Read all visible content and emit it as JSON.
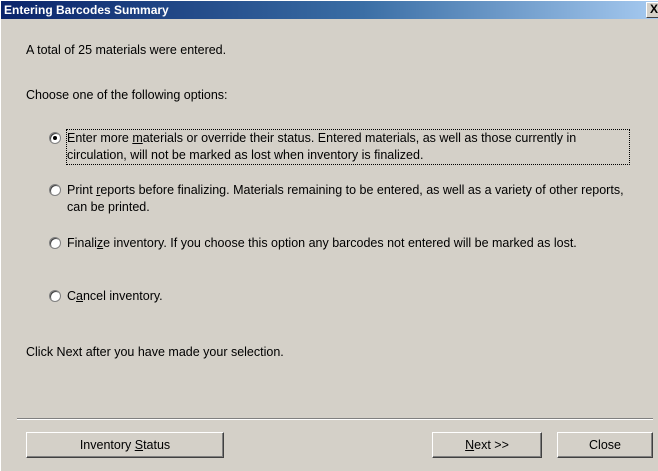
{
  "window": {
    "title": "Entering Barcodes Summary",
    "close_glyph": "X"
  },
  "summary_text": "A total of 25 materials were entered.",
  "prompt_text": "Choose one of the following options:",
  "options": [
    {
      "label_pre": "Enter more ",
      "mnemonic": "m",
      "label_post": "aterials or override their status. Entered materials, as well as those currently in circulation, will not be marked as lost when inventory is finalized.",
      "selected": true
    },
    {
      "label_pre": "Print ",
      "mnemonic": "r",
      "label_post": "eports before finalizing.  Materials remaining to be entered, as well as a variety of other reports, can be printed.",
      "selected": false
    },
    {
      "label_pre": "Finali",
      "mnemonic": "z",
      "label_post": "e inventory.  If you choose this option any barcodes not entered will be marked as lost.",
      "selected": false
    },
    {
      "label_pre": "C",
      "mnemonic": "a",
      "label_post": "ncel inventory.",
      "selected": false
    }
  ],
  "instruction_text": "Click Next after you have made your selection.",
  "buttons": {
    "inventory_status": {
      "pre": "Inventory ",
      "mnemonic": "S",
      "post": "tatus"
    },
    "next": {
      "pre": "",
      "mnemonic": "N",
      "post": "ext >>"
    },
    "close": {
      "pre": "Close",
      "mnemonic": "",
      "post": ""
    }
  }
}
